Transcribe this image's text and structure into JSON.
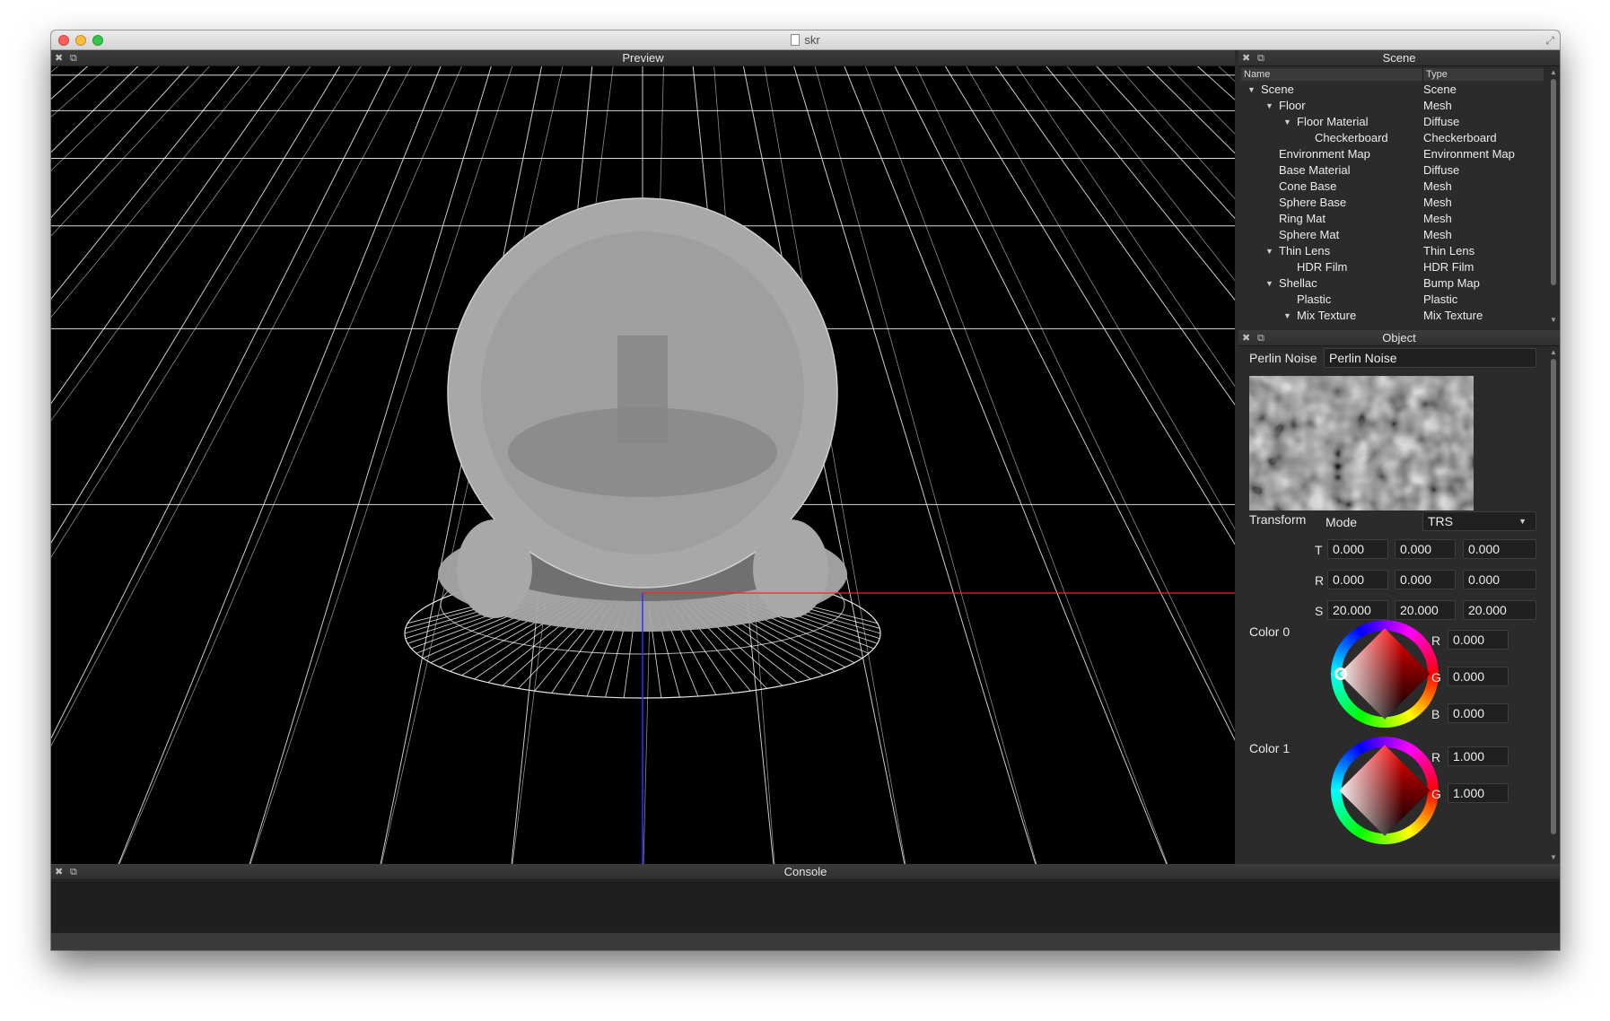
{
  "window": {
    "title": "skr",
    "traffic_lights": {
      "close": "#fc605c",
      "minimize": "#fdbc40",
      "zoom": "#34c84a"
    }
  },
  "panels": {
    "preview": {
      "title": "Preview"
    },
    "scene": {
      "title": "Scene"
    },
    "object": {
      "title": "Object"
    },
    "console": {
      "title": "Console"
    }
  },
  "panel_buttons": {
    "close_icon": "✖",
    "float_icon": "⧉"
  },
  "viewport": {
    "axis_colors": {
      "x": "#ff2020",
      "z": "#3030ff"
    },
    "mesh_color": "#a8a8a8",
    "grid_color": "#ffffff"
  },
  "scene_tree": {
    "columns": [
      "Name",
      "Type"
    ],
    "rows": [
      {
        "name": "Scene",
        "type": "Scene",
        "depth": 0,
        "expanded": true
      },
      {
        "name": "Floor",
        "type": "Mesh",
        "depth": 1,
        "expanded": true
      },
      {
        "name": "Floor Material",
        "type": "Diffuse",
        "depth": 2,
        "expanded": true
      },
      {
        "name": "Checkerboard",
        "type": "Checkerboard",
        "depth": 3,
        "expanded": null
      },
      {
        "name": "Environment Map",
        "type": "Environment Map",
        "depth": 1,
        "expanded": null
      },
      {
        "name": "Base Material",
        "type": "Diffuse",
        "depth": 1,
        "expanded": null
      },
      {
        "name": "Cone Base",
        "type": "Mesh",
        "depth": 1,
        "expanded": null
      },
      {
        "name": "Sphere Base",
        "type": "Mesh",
        "depth": 1,
        "expanded": null
      },
      {
        "name": "Ring Mat",
        "type": "Mesh",
        "depth": 1,
        "expanded": null
      },
      {
        "name": "Sphere Mat",
        "type": "Mesh",
        "depth": 1,
        "expanded": null
      },
      {
        "name": "Thin Lens",
        "type": "Thin Lens",
        "depth": 1,
        "expanded": true
      },
      {
        "name": "HDR Film",
        "type": "HDR Film",
        "depth": 2,
        "expanded": null
      },
      {
        "name": "Shellac",
        "type": "Bump Map",
        "depth": 1,
        "expanded": true
      },
      {
        "name": "Plastic",
        "type": "Plastic",
        "depth": 2,
        "expanded": null
      },
      {
        "name": "Mix Texture",
        "type": "Mix Texture",
        "depth": 2,
        "expanded": true
      }
    ]
  },
  "object": {
    "name_label": "Perlin Noise",
    "name_value": "Perlin Noise",
    "transform_label": "Transform",
    "mode_label": "Mode",
    "mode_value": "TRS",
    "t_label": "T",
    "r_label": "R",
    "s_label": "S",
    "translate": [
      "0.000",
      "0.000",
      "0.000"
    ],
    "rotate": [
      "0.000",
      "0.000",
      "0.000"
    ],
    "scale": [
      "20.000",
      "20.000",
      "20.000"
    ],
    "color0": {
      "label": "Color 0",
      "r_label": "R",
      "g_label": "G",
      "b_label": "B",
      "r": "0.000",
      "g": "0.000",
      "b": "0.000"
    },
    "color1": {
      "label": "Color 1",
      "r_label": "R",
      "g_label": "G",
      "r": "1.000",
      "g": "1.000"
    }
  },
  "console": {
    "output": ""
  }
}
